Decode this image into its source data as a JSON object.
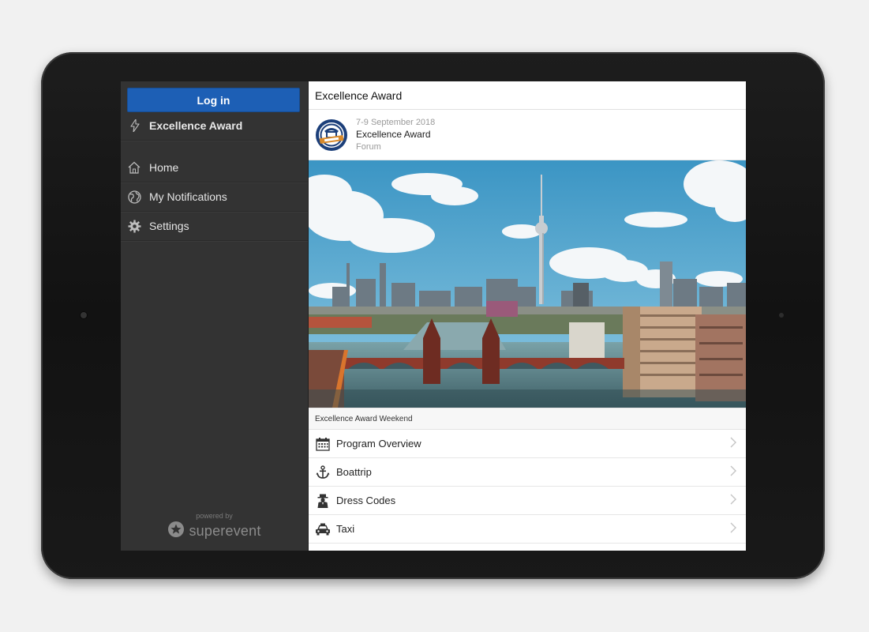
{
  "sidebar": {
    "login_label": "Log in",
    "event_label": "Excellence Award",
    "items": [
      {
        "label": "Home",
        "icon": "home-icon"
      },
      {
        "label": "My Notifications",
        "icon": "globe-icon"
      },
      {
        "label": "Settings",
        "icon": "gear-icon"
      }
    ],
    "powered_by": "powered by",
    "brand": "superevent"
  },
  "main": {
    "header_title": "Excellence Award",
    "card": {
      "date": "7-9 September 2018",
      "title": "Excellence Award",
      "subtitle": "Forum"
    },
    "caption": "Excellence Award Weekend",
    "list": [
      {
        "label": "Program Overview",
        "icon": "calendar-icon"
      },
      {
        "label": "Boattrip",
        "icon": "anchor-icon"
      },
      {
        "label": "Dress Codes",
        "icon": "dress-code-icon"
      },
      {
        "label": "Taxi",
        "icon": "taxi-icon"
      }
    ]
  },
  "colors": {
    "login_button": "#1d5fb5",
    "sidebar_bg": "#333333",
    "page_bg": "#f1f1f1"
  }
}
